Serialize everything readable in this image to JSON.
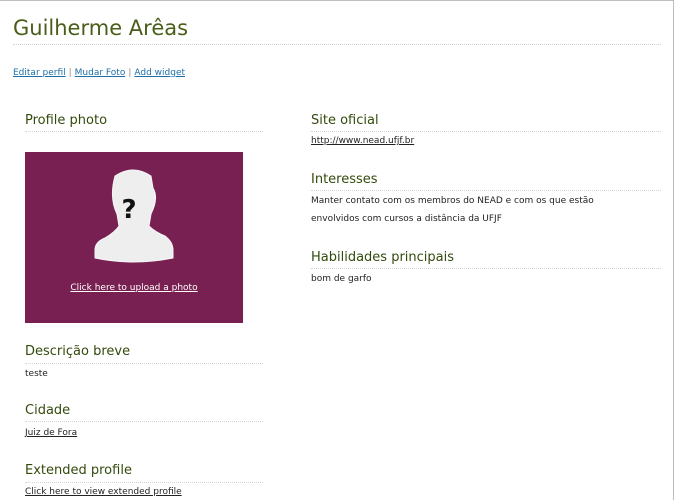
{
  "profile": {
    "name": "Guilherme Arêas",
    "actions": [
      "Editar perfil",
      "Mudar Foto",
      "Add widget"
    ]
  },
  "photo": {
    "title": "Profile photo",
    "upload_label": "Click here to upload a photo",
    "placeholder_mark": "?",
    "bg_color": "#782051"
  },
  "descricao": {
    "title": "Descrição breve",
    "value": "teste"
  },
  "cidade": {
    "title": "Cidade",
    "value": "Juiz de Fora"
  },
  "extended": {
    "title": "Extended profile",
    "link": "Click here to view extended profile"
  },
  "site": {
    "title": "Site oficial",
    "url": "http://www.nead.ufjf.br"
  },
  "interesses": {
    "title": "Interesses",
    "lines": [
      "Manter contato com os membros do NEAD e com os que estão",
      "envolvidos com cursos a distância da UFJF"
    ]
  },
  "habilidades": {
    "title": "Habilidades principais",
    "value": "bom de garfo"
  }
}
